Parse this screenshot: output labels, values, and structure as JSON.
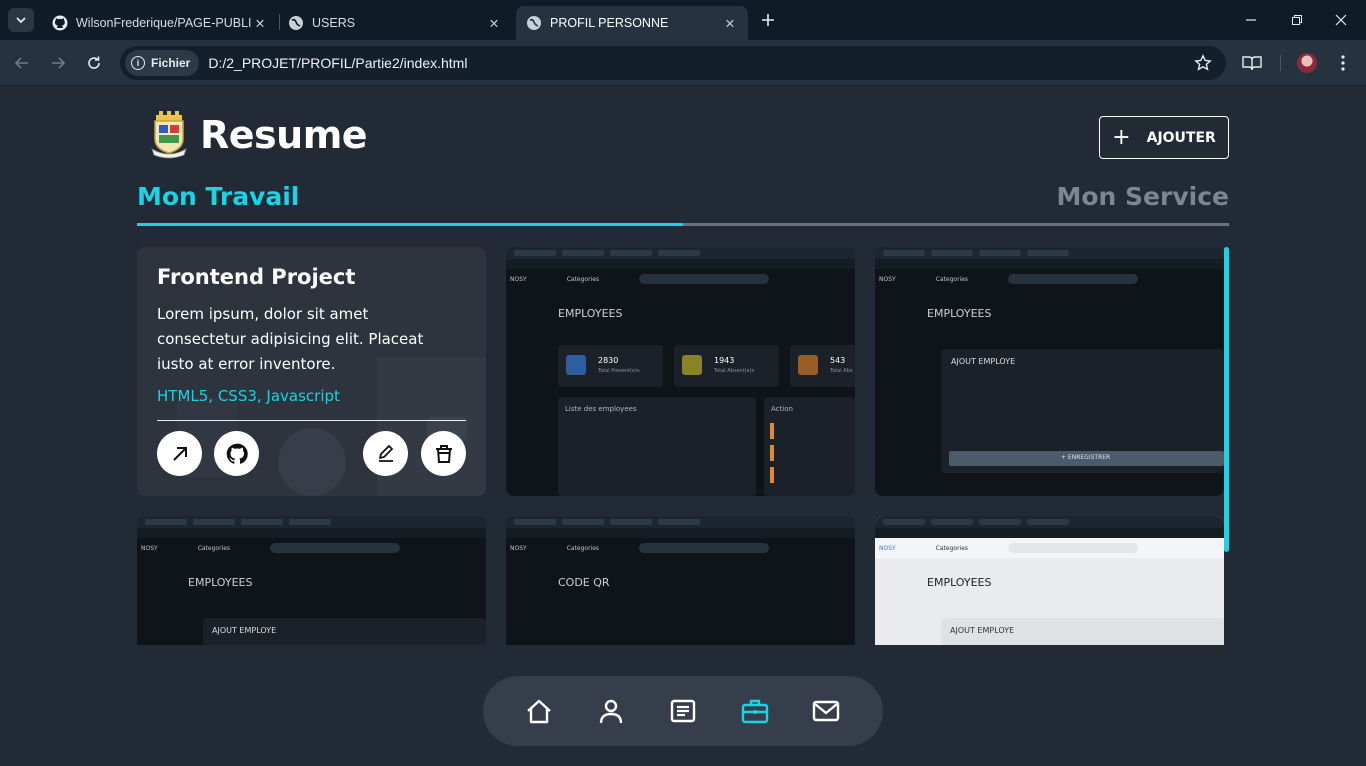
{
  "browser": {
    "tabs": [
      {
        "title": "WilsonFrederique/PAGE-PUBLIC",
        "icon": "github-icon",
        "active": false
      },
      {
        "title": "USERS",
        "icon": "globe-icon",
        "active": false
      },
      {
        "title": "PROFIL PERSONNE",
        "icon": "globe-icon",
        "active": true
      }
    ],
    "chip_label": "Fichier",
    "url": "D:/2_PROJET/PROFIL/Partie2/index.html"
  },
  "header": {
    "title": "Resume",
    "add_label": "AJOUTER"
  },
  "tabs": {
    "left": "Mon Travail",
    "right": "Mon Service",
    "progress": 0.5
  },
  "featured": {
    "title": "Frontend Project",
    "description": "Lorem ipsum, dolor sit amet consectetur adipisicing elit. Placeat iusto at error inventore.",
    "tech": "HTML5, CSS3, Javascript",
    "actions": [
      "external-link-icon",
      "github-icon",
      "edit-icon",
      "trash-icon"
    ]
  },
  "thumbs": {
    "employees": "EMPLOYEES",
    "code_qr": "CODE QR",
    "ajout": "AJOUT EMPLOYE",
    "enregistrer": "+ ENREGISTRER",
    "liste": "Liste des employees",
    "action": "Action",
    "stats": [
      {
        "value": "2830",
        "label": "Total Present(e)s"
      },
      {
        "value": "1943",
        "label": "Total Absent(e)s"
      },
      {
        "value": "543",
        "label": "Total Abs"
      }
    ],
    "nav_label": "Categories",
    "brand_frag": "NOSY"
  },
  "bottom_nav": {
    "items": [
      "home-icon",
      "user-icon",
      "article-icon",
      "briefcase-icon",
      "mail-icon"
    ],
    "active": "briefcase-icon"
  },
  "colors": {
    "accent": "#19d3e6",
    "page_bg": "#212a35",
    "tab_inactive": "#7c8590"
  }
}
